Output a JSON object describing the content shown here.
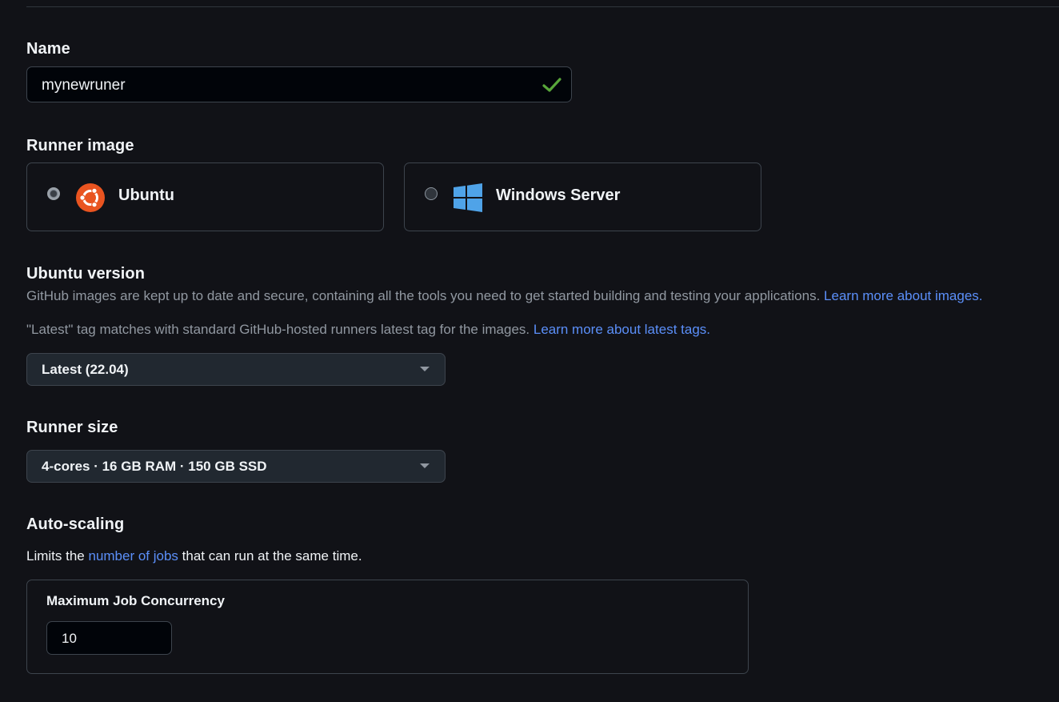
{
  "name_field": {
    "label": "Name",
    "value": "mynewruner",
    "valid_icon": "check-icon",
    "valid_color": "#3fb950"
  },
  "runner_image": {
    "label": "Runner image",
    "options": [
      {
        "label": "Ubuntu",
        "icon": "ubuntu-icon",
        "selected": true
      },
      {
        "label": "Windows Server",
        "icon": "windows-icon",
        "selected": false
      }
    ]
  },
  "ubuntu_version": {
    "label": "Ubuntu version",
    "help_text": "GitHub images are kept up to date and secure, containing all the tools you need to get started building and testing your applications.",
    "help_link": "Learn more about images.",
    "latest_text": "\"Latest\" tag matches with standard GitHub-hosted runners latest tag for the images.",
    "latest_link": "Learn more about latest tags.",
    "selected": "Latest (22.04)"
  },
  "runner_size": {
    "label": "Runner size",
    "selected": "4-cores · 16 GB RAM · 150 GB SSD"
  },
  "auto_scaling": {
    "label": "Auto-scaling",
    "desc_prefix": "Limits the",
    "desc_link": "number of jobs",
    "desc_suffix": "that can run at the same time.",
    "max_concurrency_label": "Maximum Job Concurrency",
    "max_concurrency_value": "10"
  },
  "colors": {
    "background": "#111217",
    "link": "#5b8ff9",
    "ubuntu_orange": "#e95420",
    "windows_blue": "#4fa3e8"
  }
}
